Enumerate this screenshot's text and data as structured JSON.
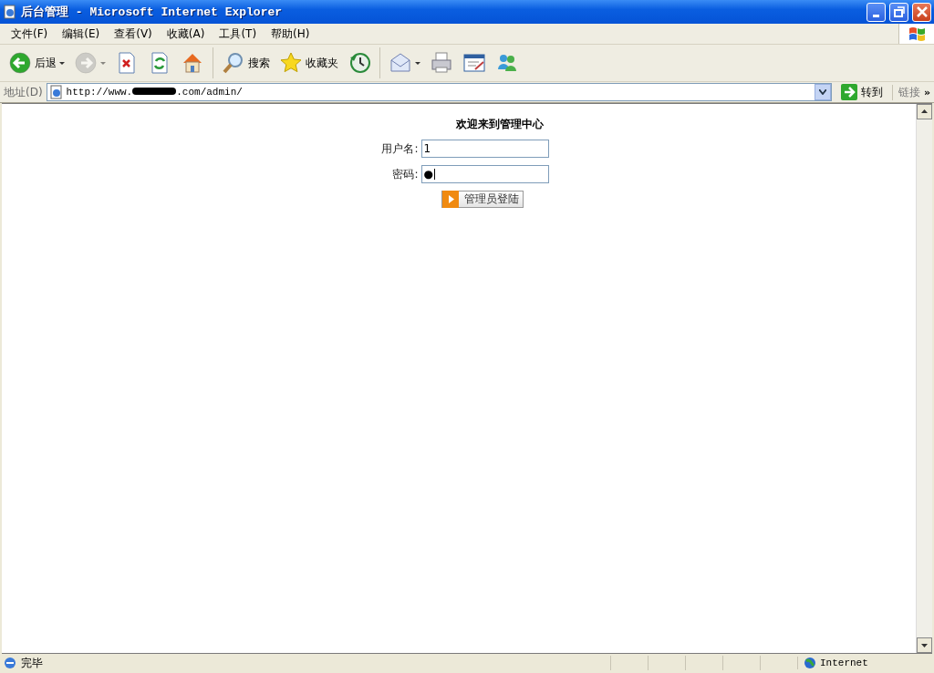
{
  "window": {
    "title": "后台管理 - Microsoft Internet Explorer"
  },
  "menu": [
    "文件(F)",
    "编辑(E)",
    "查看(V)",
    "收藏(A)",
    "工具(T)",
    "帮助(H)"
  ],
  "toolbar": {
    "back": {
      "label": "后退",
      "disabled": false
    },
    "forward": {
      "disabled": true
    },
    "search": {
      "label": "搜索"
    },
    "favorites": {
      "label": "收藏夹"
    }
  },
  "address_bar": {
    "label": "地址(D)",
    "url_start": "http://www.",
    "url_end": ".com/admin/",
    "go": "转到",
    "links": "链接",
    "more": "»"
  },
  "page": {
    "heading": "欢迎来到管理中心",
    "fields": [
      {
        "label": "用户名:",
        "value": "1"
      },
      {
        "label": "密码:",
        "value": "●"
      }
    ],
    "submit": "管理员登陆"
  },
  "status_bar": {
    "text": "完毕",
    "zone": "Internet"
  }
}
